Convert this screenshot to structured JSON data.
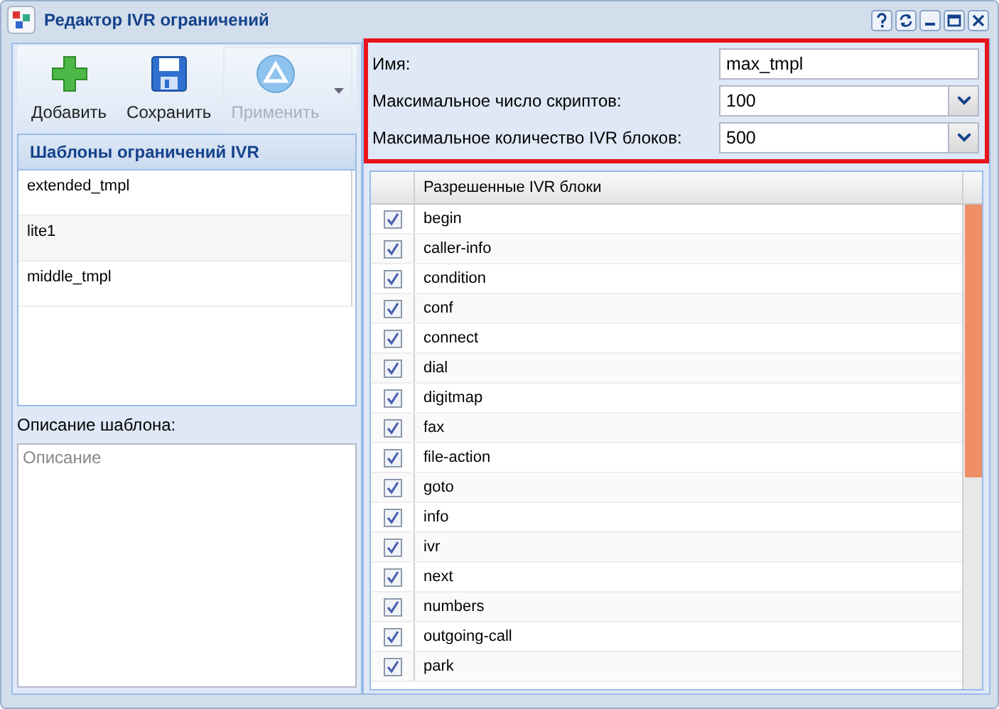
{
  "window": {
    "title": "Редактор IVR ограничений"
  },
  "toolbar": [
    {
      "kind": "add",
      "label": "Добавить",
      "disabled": false,
      "menu": false
    },
    {
      "kind": "save",
      "label": "Сохранить",
      "disabled": false,
      "menu": false
    },
    {
      "kind": "apply",
      "label": "Применить",
      "disabled": true,
      "menu": true
    }
  ],
  "templates": {
    "title": "Шаблоны ограничений IVR",
    "items": [
      {
        "name": "extended_tmpl",
        "selected": false
      },
      {
        "name": "lite1",
        "selected": false
      },
      {
        "name": "middle_tmpl",
        "selected": false
      }
    ]
  },
  "description": {
    "label": "Описание шаблона:",
    "placeholder": "Описание"
  },
  "form": [
    {
      "kind": "text",
      "label": "Имя:",
      "value": "max_tmpl"
    },
    {
      "kind": "select",
      "label": "Максимальное число скриптов:",
      "value": "100"
    },
    {
      "kind": "select",
      "label": "Максимальное количество IVR блоков:",
      "value": "500"
    }
  ],
  "blocks": {
    "column": "Разрешенные IVR блоки",
    "rows": [
      {
        "name": "begin",
        "checked": true
      },
      {
        "name": "caller-info",
        "checked": true
      },
      {
        "name": "condition",
        "checked": true
      },
      {
        "name": "conf",
        "checked": true
      },
      {
        "name": "connect",
        "checked": true
      },
      {
        "name": "dial",
        "checked": true
      },
      {
        "name": "digitmap",
        "checked": true
      },
      {
        "name": "fax",
        "checked": true
      },
      {
        "name": "file-action",
        "checked": true
      },
      {
        "name": "goto",
        "checked": true
      },
      {
        "name": "info",
        "checked": true
      },
      {
        "name": "ivr",
        "checked": true
      },
      {
        "name": "next",
        "checked": true
      },
      {
        "name": "numbers",
        "checked": true
      },
      {
        "name": "outgoing-call",
        "checked": true
      },
      {
        "name": "park",
        "checked": true
      }
    ]
  }
}
